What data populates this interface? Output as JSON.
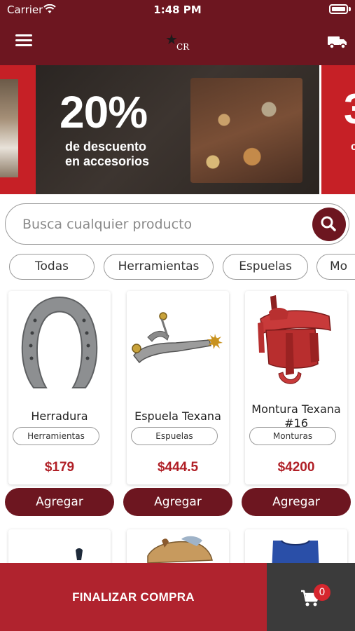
{
  "status_bar": {
    "carrier": "Carrier",
    "time": "1:48 PM"
  },
  "header": {
    "logo_text": "CR"
  },
  "banner": {
    "main_big": "20%",
    "main_line1": "de descuento",
    "main_line2": "en accesorios",
    "right_peek": "3",
    "right_peek_small": "c"
  },
  "search": {
    "placeholder": "Busca cualquier producto"
  },
  "categories": [
    "Todas",
    "Herramientas",
    "Espuelas",
    "Mo"
  ],
  "products": [
    {
      "name": "Herradura",
      "category": "Herramientas",
      "price": "$179",
      "button": "Agregar"
    },
    {
      "name": "Espuela Texana",
      "category": "Espuelas",
      "price": "$444.5",
      "button": "Agregar"
    },
    {
      "name": "Montura Texana #16",
      "category": "Monturas",
      "price": "$4200",
      "button": "Agregar"
    }
  ],
  "checkout": {
    "label": "FINALIZAR COMPRA"
  },
  "cart": {
    "count": "0"
  },
  "colors": {
    "brand": "#6d1620",
    "accent": "#b01f26",
    "cart_bg": "#3b3b3b"
  },
  "icons": [
    "menu-icon",
    "logo-star-icon",
    "truck-icon",
    "search-icon",
    "cart-icon",
    "wifi-icon",
    "battery-icon"
  ]
}
